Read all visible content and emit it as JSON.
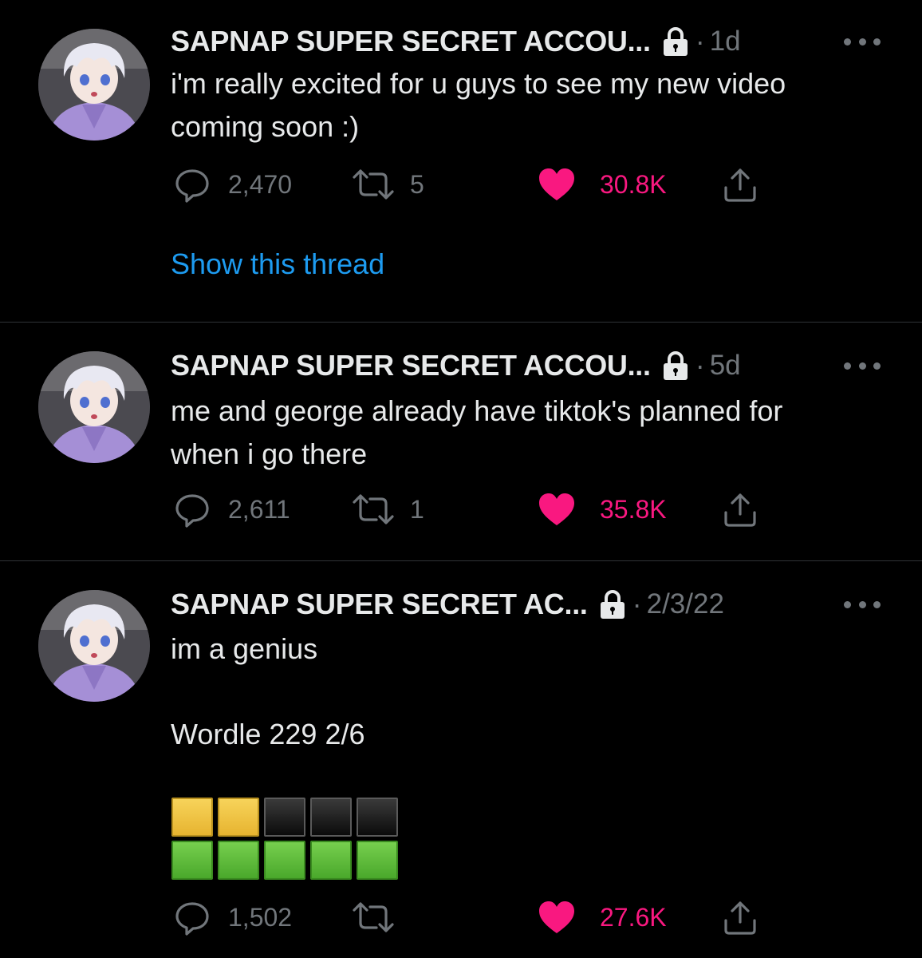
{
  "colors": {
    "background": "#000000",
    "text": "#e7e9ea",
    "muted": "#71767b",
    "like": "#f91880",
    "link": "#1d9bf0"
  },
  "tweets": [
    {
      "name": "SAPNAP SUPER SECRET ACCOU...",
      "dot": "·",
      "time": "1d",
      "text_lines": [
        "i'm really excited for u guys to see my new video",
        "coming soon :)"
      ],
      "replies": "2,470",
      "retweets": "5",
      "likes": "30.8K",
      "show_thread": "Show this thread",
      "icons": [
        "lock-icon",
        "more-icon",
        "reply-icon",
        "retweet-icon",
        "heart-icon",
        "share-icon"
      ]
    },
    {
      "name": "SAPNAP SUPER SECRET ACCOU...",
      "dot": "·",
      "time": "5d",
      "text_lines": [
        "me and george already have tiktok's planned for",
        "when i go there"
      ],
      "replies": "2,611",
      "retweets": "1",
      "likes": "35.8K"
    },
    {
      "name": "SAPNAP SUPER SECRET AC...",
      "dot": "·",
      "time": "2/3/22",
      "text_lines": [
        "im a genius"
      ],
      "wordle_title": "Wordle 229 2/6",
      "wordle_grid": [
        [
          "yellow",
          "yellow",
          "black",
          "black",
          "black"
        ],
        [
          "green",
          "green",
          "green",
          "green",
          "green"
        ]
      ],
      "replies": "1,502",
      "retweets": "",
      "likes": "27.6K"
    }
  ]
}
